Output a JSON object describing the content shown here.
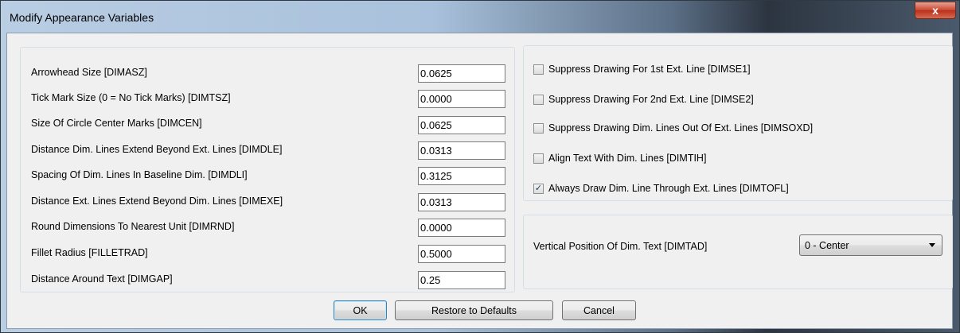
{
  "window": {
    "title": "Modify Appearance Variables",
    "close_label": "x"
  },
  "variables": [
    {
      "label": "Arrowhead Size [DIMASZ]",
      "value": "0.0625"
    },
    {
      "label": "Tick Mark Size (0 = No Tick Marks) [DIMTSZ]",
      "value": "0.0000"
    },
    {
      "label": "Size Of Circle Center Marks [DIMCEN]",
      "value": "0.0625"
    },
    {
      "label": "Distance Dim. Lines Extend Beyond Ext. Lines [DIMDLE]",
      "value": "0.0313"
    },
    {
      "label": "Spacing Of Dim. Lines In Baseline Dim. [DIMDLI]",
      "value": "0.3125"
    },
    {
      "label": "Distance Ext. Lines Extend Beyond Dim. Lines [DIMEXE]",
      "value": "0.0313"
    },
    {
      "label": "Round Dimensions To Nearest Unit [DIMRND]",
      "value": "0.0000"
    },
    {
      "label": "Fillet Radius [FILLETRAD]",
      "value": "0.5000"
    },
    {
      "label": "Distance Around Text [DIMGAP]",
      "value": "0.25"
    }
  ],
  "checkboxes": [
    {
      "label": "Suppress Drawing For 1st Ext. Line [DIMSE1]",
      "checked": false
    },
    {
      "label": "Suppress Drawing For 2nd Ext. Line [DIMSE2]",
      "checked": false
    },
    {
      "label": "Suppress Drawing Dim. Lines Out Of Ext. Lines [DIMSOXD]",
      "checked": false
    },
    {
      "label": "Align Text With Dim. Lines [DIMTIH]",
      "checked": false
    },
    {
      "label": "Always Draw Dim. Line Through Ext. Lines [DIMTOFL]",
      "checked": true
    }
  ],
  "vertical_position": {
    "label": "Vertical Position Of Dim. Text [DIMTAD]",
    "selected": "0 - Center"
  },
  "buttons": {
    "ok": "OK",
    "restore": "Restore to Defaults",
    "cancel": "Cancel"
  },
  "check_mark": "✓"
}
